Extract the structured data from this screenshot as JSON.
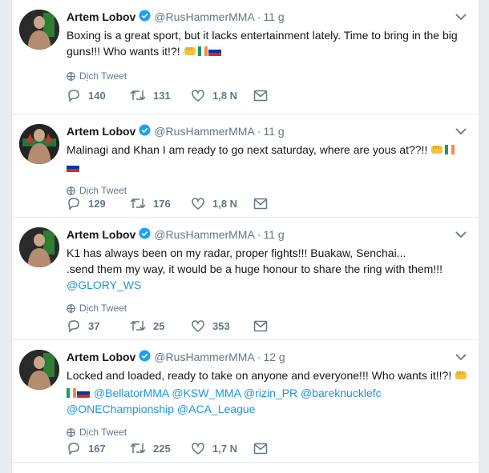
{
  "tweets": [
    {
      "name": "Artem Lobov",
      "handle": "@RusHammerMMA",
      "time": "11 g",
      "lines": [
        "Boxing is a great sport, but it lacks entertainment lately. Time to bring in the big",
        "guns!!! Who wants it!?!"
      ],
      "translate": "Dịch Tweet",
      "replies": "140",
      "retweets": "131",
      "likes": "1,8 N"
    },
    {
      "name": "Artem Lobov",
      "handle": "@RusHammerMMA",
      "time": "11 g",
      "lines": [
        "Malinagi and Khan I am ready to go next saturday, where are yous at??!!"
      ],
      "translate": "Dịch Tweet",
      "replies": "129",
      "retweets": "176",
      "likes": "1,8 N"
    },
    {
      "name": "Artem Lobov",
      "handle": "@RusHammerMMA",
      "time": "11 g",
      "lines": [
        "K1 has always been on my radar, proper fights!!! Buakaw, Senchai...",
        ".send them my way, it would be a huge honour to share the ring with them!!!"
      ],
      "mention": "@GLORY_WS",
      "translate": "Dịch Tweet",
      "replies": "37",
      "retweets": "25",
      "likes": "353"
    },
    {
      "name": "Artem Lobov",
      "handle": "@RusHammerMMA",
      "time": "12 g",
      "lines": [
        "Locked and loaded, ready to take on anyone and everyone!!! Who wants it!!?!"
      ],
      "mentions_line1": "@BellatorMMA @KSW_MMA @rizin_PR @bareknucklefc",
      "mentions_line2": "@ONEChampionship @ACA_League",
      "translate": "Dịch Tweet",
      "replies": "167",
      "retweets": "225",
      "likes": "1,7 N"
    }
  ],
  "colors": {
    "accent": "#1b95e0",
    "muted": "#657786",
    "verified": "#1da1f2"
  },
  "icons": [
    "verified-badge-icon",
    "chevron-down-icon",
    "globe-icon",
    "reply-icon",
    "retweet-icon",
    "like-icon",
    "direct-message-icon",
    "fist-emoji",
    "irish-flag",
    "russian-flag"
  ]
}
